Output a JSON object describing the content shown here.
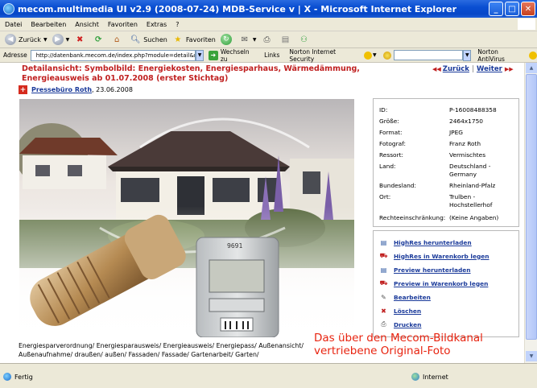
{
  "window": {
    "title": "mecom.multimedia UI v2.9 (2008-07-24) MDB-Service v | X - Microsoft Internet Explorer",
    "minimize": "_",
    "maximize": "□",
    "close": "✕"
  },
  "menu": [
    "Datei",
    "Bearbeiten",
    "Ansicht",
    "Favoriten",
    "Extras",
    "?"
  ],
  "toolbar": {
    "back": "Zurück",
    "search": "Suchen",
    "favorites": "Favoriten"
  },
  "addressbar": {
    "label": "Adresse",
    "url": "http://datenbank.mecom.de/index.php?module=detail&mmo_v",
    "go": "Wechseln zu",
    "links": "Links",
    "norton_security": "Norton Internet Security",
    "norton_antivirus": "Norton AntiVirus"
  },
  "page": {
    "title": "Detailansicht: Symbolbild: Energiekosten, Energiesparhaus, Wärmedämmung, Energieausweis ab 01.07.2008 (erster Stichtag)",
    "nav_back": "Zurück",
    "nav_forward": "Weiter",
    "source_name": "Pressebüro Roth",
    "source_date": ", 23.06.2008",
    "thermometer_display": "9691",
    "keywords": "Energiesparverordnung/ Energiesparausweis/ Energieausweis/ Energiepass/ Außenansicht/ Außenaufnahme/ draußen/ außen/ Fassaden/ Fassade/ Gartenarbeit/ Garten/"
  },
  "details": [
    {
      "label": "ID:",
      "value": "P-16008488358"
    },
    {
      "label": "Größe:",
      "value": "2464x1750"
    },
    {
      "label": "Format:",
      "value": "JPEG"
    },
    {
      "label": "Fotograf:",
      "value": "Franz Roth"
    },
    {
      "label": "Ressort:",
      "value": "Vermischtes"
    },
    {
      "label": "Land:",
      "value": "Deutschland - Germany"
    },
    {
      "label": "Bundesland:",
      "value": "Rheinland-Pfalz"
    },
    {
      "label": "Ort:",
      "value": "Trulben - Hochstellerhof"
    },
    {
      "label": "Rechteeinschränkung:",
      "value": "(Keine Angaben)"
    }
  ],
  "actions": [
    {
      "label": "HighRes herunterladen",
      "icon": "download-icon"
    },
    {
      "label": "HighRes in Warenkorb legen",
      "icon": "cart-icon"
    },
    {
      "label": "Preview herunterladen",
      "icon": "download-icon"
    },
    {
      "label": "Preview in Warenkorb legen",
      "icon": "cart-icon"
    },
    {
      "label": "Bearbeiten",
      "icon": "edit-icon"
    },
    {
      "label": "Löschen",
      "icon": "delete-icon"
    },
    {
      "label": "Drucken",
      "icon": "print-icon"
    }
  ],
  "caption": "Das über den Mecom-Bildkanal vertriebene Original-Foto",
  "status": {
    "left": "Fertig",
    "zone": "Internet"
  }
}
